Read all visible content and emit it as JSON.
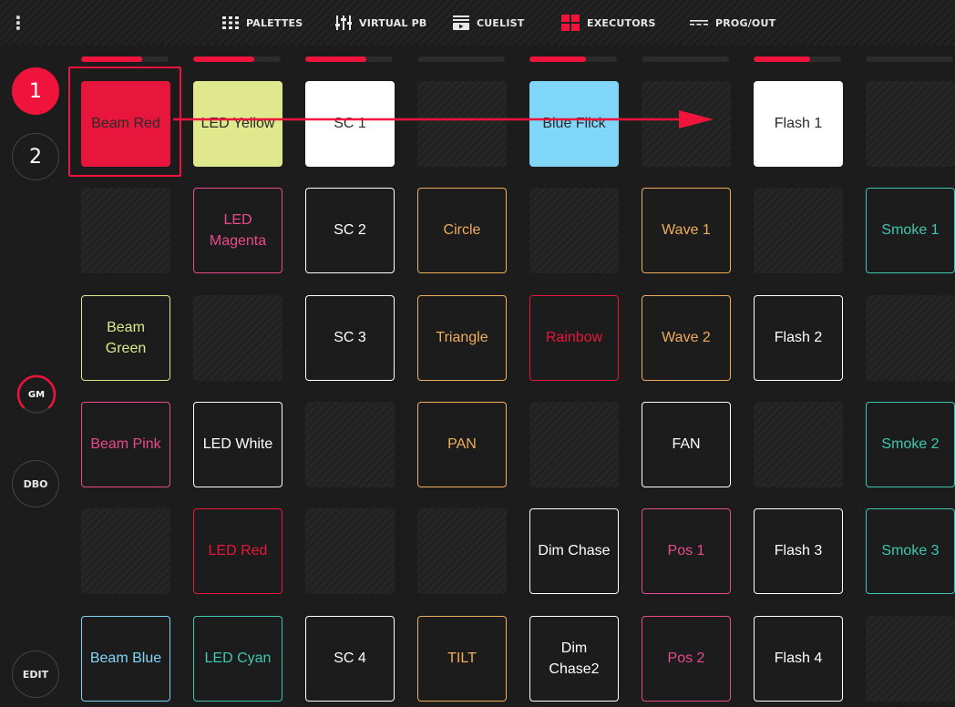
{
  "topbar": {
    "menu_glyph": "⋮",
    "nav": [
      {
        "label": "PALETTES",
        "icon": "grid-dots-icon"
      },
      {
        "label": "VIRTUAL PB",
        "icon": "faders-icon"
      },
      {
        "label": "CUELIST",
        "icon": "cuelist-icon"
      },
      {
        "label": "EXECUTORS",
        "icon": "executors-icon"
      },
      {
        "label": "PROG/OUT",
        "icon": "prog-out-icon"
      }
    ]
  },
  "sidebar": {
    "pages": [
      "1",
      "2"
    ],
    "active_page": "1",
    "gm_label": "GM",
    "dbo_label": "DBO",
    "edit_label": "EDIT"
  },
  "colors": {
    "accent": "#f0143c",
    "red": "#e8163c",
    "yellow": "#dfe88c",
    "white": "#ffffff",
    "blue": "#7fd6f8",
    "magenta": "#e94a8c",
    "orange": "#f0ad5a",
    "green": "#dfe88c",
    "teal": "#3cc8b0",
    "cyan": "#3cc8b0",
    "lightblue": "#7fd6f8",
    "pink": "#e94a8c"
  },
  "column_levels": [
    0.7,
    0.7,
    0.7,
    0,
    0.65,
    0,
    0.65,
    0
  ],
  "pads": [
    [
      {
        "label": "Beam Red",
        "style": "filled",
        "color": "red"
      },
      {
        "label": "LED Yellow",
        "style": "filled",
        "color": "yellow"
      },
      {
        "label": "SC 1",
        "style": "filled",
        "color": "white"
      },
      {
        "label": "",
        "style": "empty"
      },
      {
        "label": "Blue Flick",
        "style": "filled",
        "color": "blue"
      },
      {
        "label": "",
        "style": "empty"
      },
      {
        "label": "Flash 1",
        "style": "filled",
        "color": "white"
      },
      {
        "label": "",
        "style": "empty"
      }
    ],
    [
      {
        "label": "",
        "style": "empty"
      },
      {
        "label": "LED Magenta",
        "style": "outline",
        "color": "magenta"
      },
      {
        "label": "SC 2",
        "style": "outline",
        "color": "white"
      },
      {
        "label": "Circle",
        "style": "outline",
        "color": "orange"
      },
      {
        "label": "",
        "style": "empty"
      },
      {
        "label": "Wave 1",
        "style": "outline",
        "color": "orange"
      },
      {
        "label": "",
        "style": "empty"
      },
      {
        "label": "Smoke 1",
        "style": "outline",
        "color": "teal"
      }
    ],
    [
      {
        "label": "Beam Green",
        "style": "outline",
        "color": "green"
      },
      {
        "label": "",
        "style": "empty"
      },
      {
        "label": "SC 3",
        "style": "outline",
        "color": "white"
      },
      {
        "label": "Triangle",
        "style": "outline",
        "color": "orange"
      },
      {
        "label": "Rainbow",
        "style": "outline",
        "color": "red"
      },
      {
        "label": "Wave 2",
        "style": "outline",
        "color": "orange"
      },
      {
        "label": "Flash 2",
        "style": "outline",
        "color": "white"
      },
      {
        "label": "",
        "style": "empty"
      }
    ],
    [
      {
        "label": "Beam Pink",
        "style": "outline",
        "color": "pink"
      },
      {
        "label": "LED White",
        "style": "outline",
        "color": "white"
      },
      {
        "label": "",
        "style": "empty"
      },
      {
        "label": "PAN",
        "style": "outline",
        "color": "orange"
      },
      {
        "label": "",
        "style": "empty"
      },
      {
        "label": "FAN",
        "style": "outline",
        "color": "white"
      },
      {
        "label": "",
        "style": "empty"
      },
      {
        "label": "Smoke 2",
        "style": "outline",
        "color": "teal"
      }
    ],
    [
      {
        "label": "",
        "style": "empty"
      },
      {
        "label": "LED Red",
        "style": "outline",
        "color": "red"
      },
      {
        "label": "",
        "style": "empty"
      },
      {
        "label": "",
        "style": "empty"
      },
      {
        "label": "Dim Chase",
        "style": "outline",
        "color": "white"
      },
      {
        "label": "Pos 1",
        "style": "outline",
        "color": "pink"
      },
      {
        "label": "Flash 3",
        "style": "outline",
        "color": "white"
      },
      {
        "label": "Smoke 3",
        "style": "outline",
        "color": "teal"
      }
    ],
    [
      {
        "label": "Beam Blue",
        "style": "outline",
        "color": "lightblue"
      },
      {
        "label": "LED Cyan",
        "style": "outline",
        "color": "cyan"
      },
      {
        "label": "SC 4",
        "style": "outline",
        "color": "white"
      },
      {
        "label": "TILT",
        "style": "outline",
        "color": "orange"
      },
      {
        "label": "Dim Chase2",
        "style": "outline",
        "color": "white"
      },
      {
        "label": "Pos 2",
        "style": "outline",
        "color": "pink"
      },
      {
        "label": "Flash 4",
        "style": "outline",
        "color": "white"
      },
      {
        "label": "",
        "style": "empty"
      }
    ]
  ]
}
